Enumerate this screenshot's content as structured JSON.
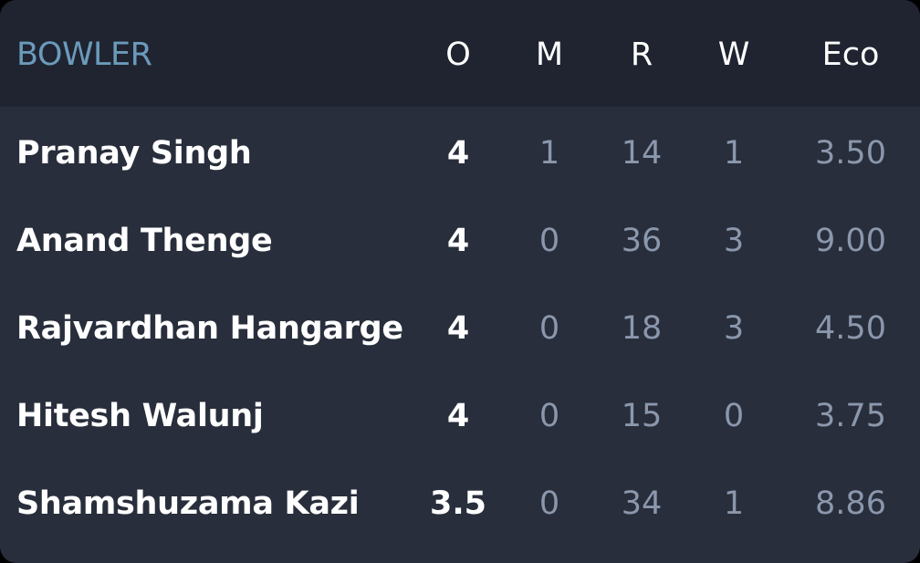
{
  "header": {
    "bowler": "BOWLER",
    "overs": "O",
    "maidens": "M",
    "runs": "R",
    "wickets": "W",
    "economy": "Eco"
  },
  "rows": [
    {
      "name": "Pranay Singh",
      "overs": "4",
      "maidens": "1",
      "runs": "14",
      "wickets": "1",
      "economy": "3.50"
    },
    {
      "name": "Anand Thenge",
      "overs": "4",
      "maidens": "0",
      "runs": "36",
      "wickets": "3",
      "economy": "9.00"
    },
    {
      "name": "Rajvardhan Hangarge…",
      "overs": "4",
      "maidens": "0",
      "runs": "18",
      "wickets": "3",
      "economy": "4.50"
    },
    {
      "name": "Hitesh Walunj",
      "overs": "4",
      "maidens": "0",
      "runs": "15",
      "wickets": "0",
      "economy": "3.75"
    },
    {
      "name": "Shamshuzama Kazi",
      "overs": "3.5",
      "maidens": "0",
      "runs": "34",
      "wickets": "1",
      "economy": "8.86"
    }
  ],
  "colors": {
    "card_bg": "#282e3b",
    "header_bg": "#1f2430",
    "bowler_header": "#6b9abb",
    "primary_text": "#ffffff",
    "secondary_text": "#8b97ac"
  }
}
